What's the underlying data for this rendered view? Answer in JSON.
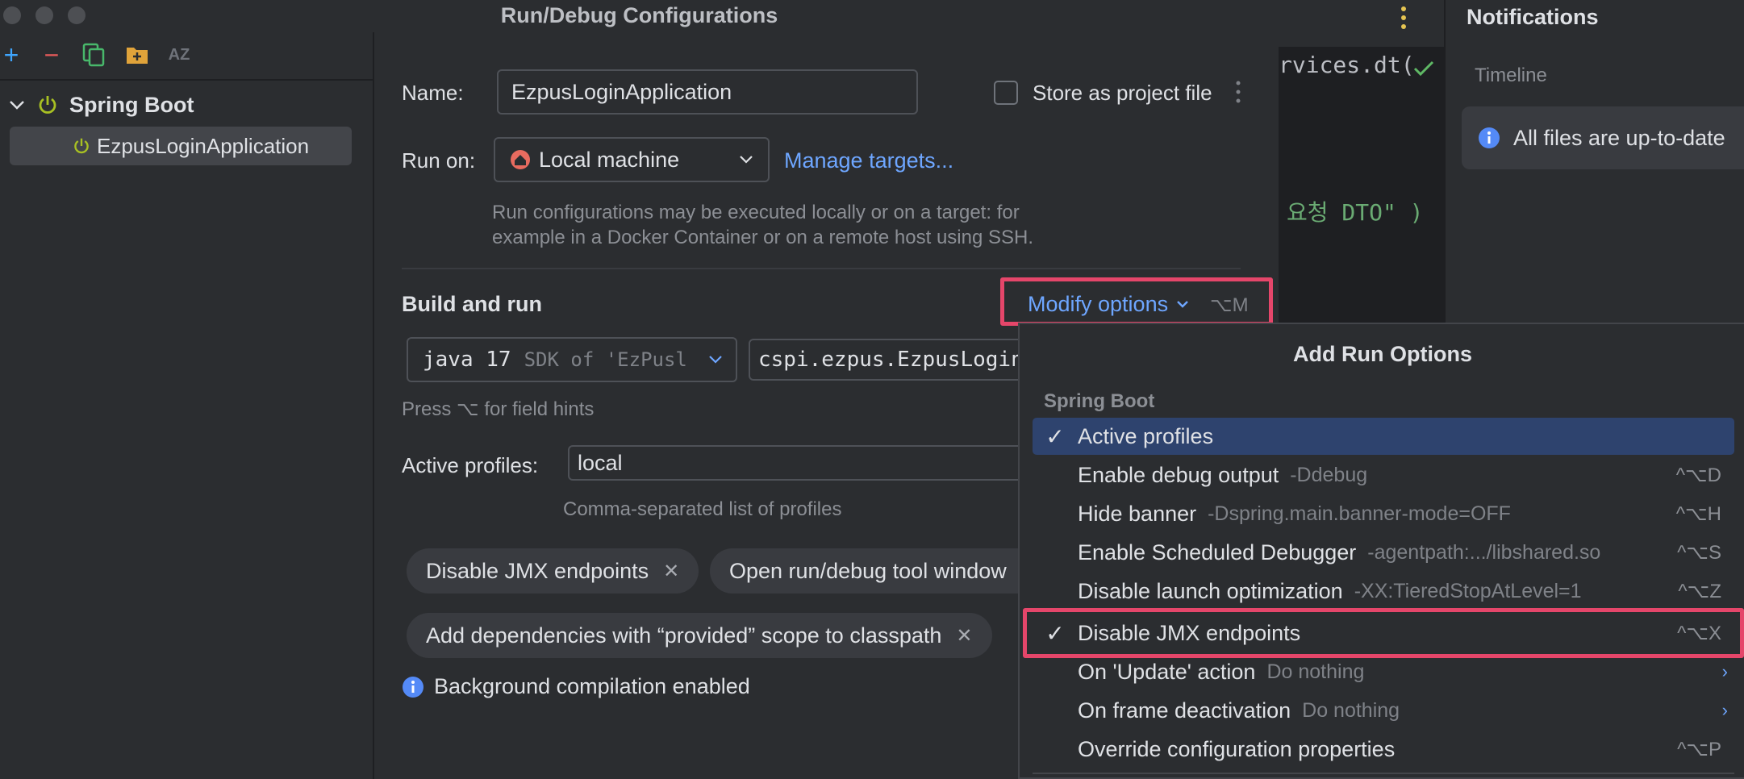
{
  "dialog": {
    "title": "Run/Debug Configurations",
    "toolbar": {
      "add": "+",
      "remove": "−",
      "sort": "AZ"
    },
    "tree": {
      "group": "Spring Boot",
      "item": "EzpusLoginApplication"
    },
    "name": {
      "label": "Name:",
      "value": "EzpusLoginApplication"
    },
    "store_project_file": "Store as project file",
    "run_on": {
      "label": "Run on:",
      "value": "Local machine",
      "manage": "Manage targets...",
      "hint_line1": "Run configurations may be executed locally or on a target: for",
      "hint_line2": "example in a Docker Container or on a remote host using SSH."
    },
    "build_and_run": {
      "title": "Build and run",
      "modify": "Modify options",
      "modify_shortcut": "⌥M",
      "sdk": "java 17",
      "sdk_detail": "SDK of 'EzPusl",
      "main_class": "cspi.ezpus.EzpusLogin",
      "field_hint": "Press ⌥ for field hints"
    },
    "active_profiles": {
      "label": "Active profiles:",
      "value": "local",
      "hint": "Comma-separated list of profiles"
    },
    "chips": [
      "Disable JMX endpoints",
      "Open run/debug tool window",
      "Add dependencies with “provided” scope to classpath"
    ],
    "info": "Background compilation enabled"
  },
  "editor": {
    "line1": "rvices.dt(",
    "line2": "요청 DTO\" )"
  },
  "notifications": {
    "title": "Notifications",
    "tab": "Timeline",
    "message": "All files are up-to-date"
  },
  "popup": {
    "title": "Add Run Options",
    "section": "Spring Boot",
    "items": [
      {
        "label": "Active profiles",
        "desc": "",
        "shortcut": "",
        "checked": "✓"
      },
      {
        "label": "Enable debug output",
        "desc": "-Ddebug",
        "shortcut": "^⌥D",
        "checked": ""
      },
      {
        "label": "Hide banner",
        "desc": "-Dspring.main.banner-mode=OFF",
        "shortcut": "^⌥H",
        "checked": ""
      },
      {
        "label": "Enable Scheduled Debugger",
        "desc": "-agentpath:.../libshared.so",
        "shortcut": "^⌥S",
        "checked": ""
      },
      {
        "label": "Disable launch optimization",
        "desc": "-XX:TieredStopAtLevel=1",
        "shortcut": "^⌥Z",
        "checked": ""
      },
      {
        "label": "Disable JMX endpoints",
        "desc": "",
        "shortcut": "^⌥X",
        "checked": "✓"
      },
      {
        "label": "On 'Update' action",
        "desc": "Do nothing",
        "shortcut": "",
        "checked": ""
      },
      {
        "label": "On frame deactivation",
        "desc": "Do nothing",
        "shortcut": "",
        "checked": ""
      },
      {
        "label": "Override configuration properties",
        "desc": "",
        "shortcut": "^⌥P",
        "checked": ""
      }
    ]
  },
  "colors": {
    "accent_red": "#e5466a",
    "link_blue": "#6ea6ff",
    "selection": "#2e436e",
    "spring_green": "#a8c023"
  }
}
